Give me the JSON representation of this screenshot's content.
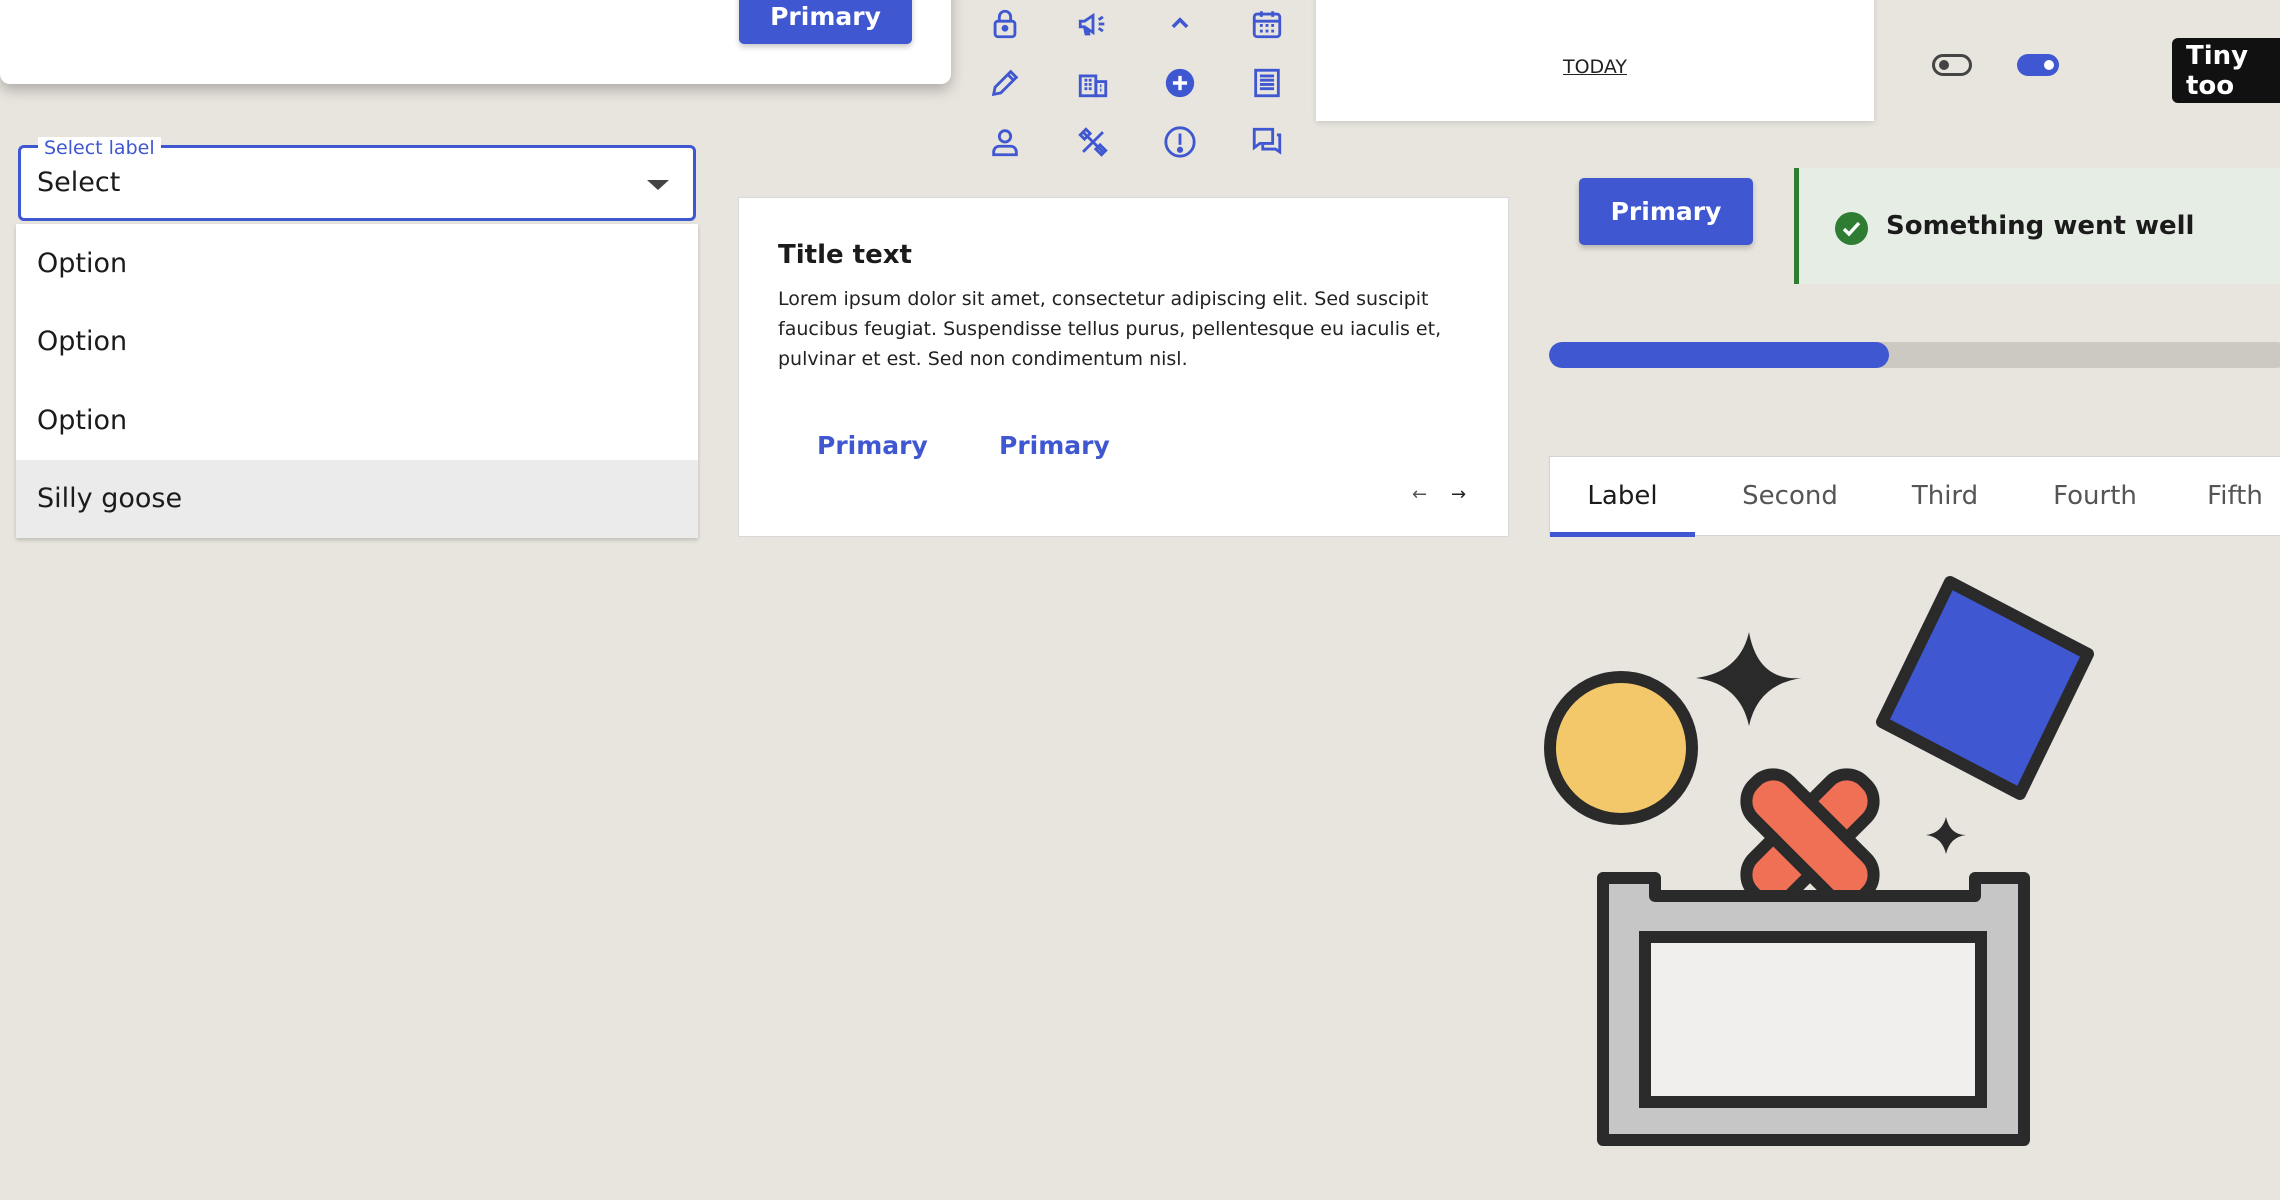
{
  "modal": {
    "primary_label": "Primary"
  },
  "select": {
    "label": "Select label",
    "value": "Select",
    "options": [
      "Option",
      "Option",
      "Option",
      "Silly goose"
    ],
    "highlighted_index": 3
  },
  "icon_grid": {
    "icons": [
      "lock-icon",
      "megaphone-icon",
      "chevron-up-icon",
      "calendar-icon",
      "pencil-icon",
      "building-icon",
      "plus-circle-icon",
      "document-icon",
      "person-icon",
      "tools-icon",
      "alert-circle-icon",
      "chat-icon"
    ],
    "color": "#3f57d0"
  },
  "calendar": {
    "today_label": "TODAY"
  },
  "toggles": {
    "off": false,
    "on": true
  },
  "tooltip": {
    "text": "Tiny too"
  },
  "card": {
    "title": "Title text",
    "body": "Lorem ipsum dolor sit amet, consectetur adipiscing elit. Sed suscipit faucibus feugiat. Suspendisse tellus purus, pellentesque eu iaculis et, pulvinar et est. Sed non condimentum nisl.",
    "button_1": "Primary",
    "button_2": "Primary",
    "arrow_prev": "←",
    "arrow_next": "→"
  },
  "primary_button": {
    "label": "Primary"
  },
  "notification": {
    "text": "Something went well",
    "status_color": "#2e7d32"
  },
  "progress": {
    "value": 0.46
  },
  "tabs": {
    "items": [
      "Label",
      "Second",
      "Third",
      "Fourth",
      "Fifth"
    ],
    "active": 0
  },
  "colors": {
    "accent": "#3f57d0",
    "background": "#e8e5de",
    "success": "#2e7d32"
  },
  "illustration": {
    "name": "empty-box-illustration"
  }
}
